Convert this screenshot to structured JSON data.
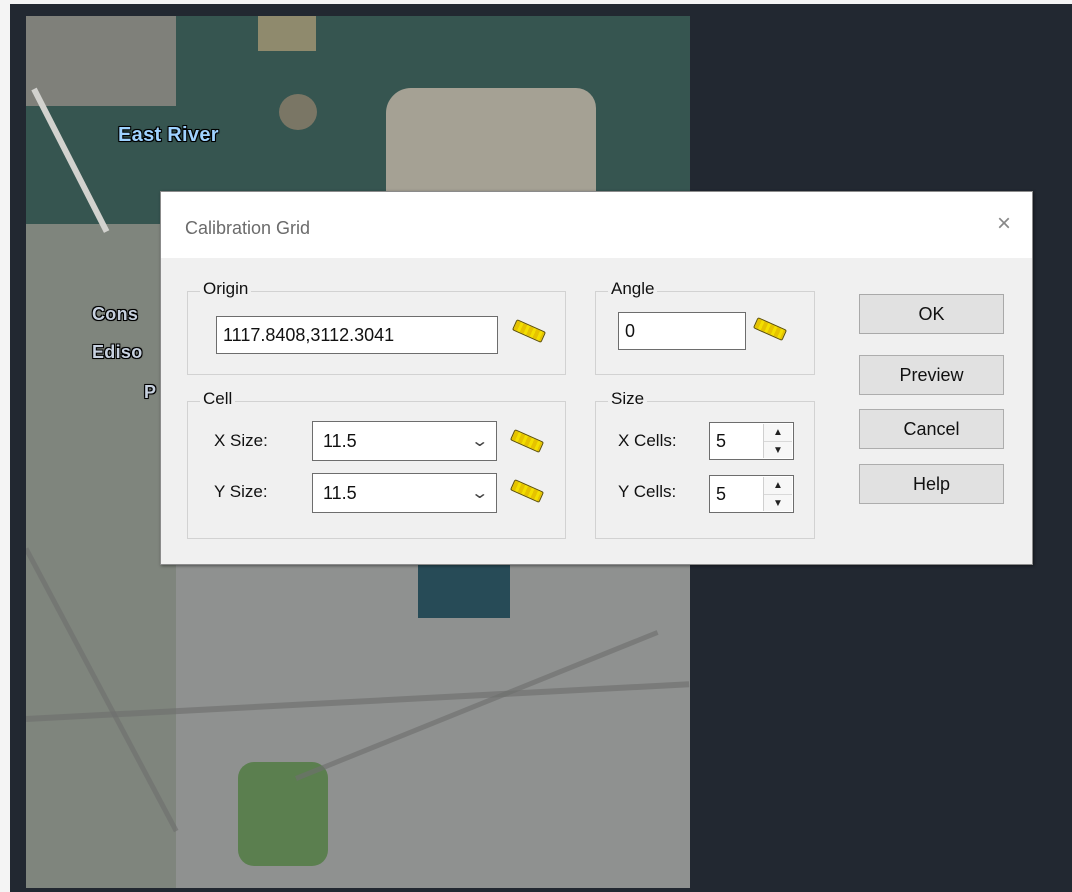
{
  "map": {
    "labels": [
      {
        "text": "East River"
      },
      {
        "text": "Cons"
      },
      {
        "text": "Ediso"
      },
      {
        "text": "P"
      }
    ]
  },
  "dialog": {
    "title": "Calibration Grid",
    "close_icon": "close-icon",
    "origin": {
      "group_label": "Origin",
      "value": "1117.8408,3112.3041",
      "ruler_icon": "ruler-icon"
    },
    "angle": {
      "group_label": "Angle",
      "value": "0",
      "ruler_icon": "ruler-icon"
    },
    "cell": {
      "group_label": "Cell",
      "x_label": "X Size:",
      "x_value": "11.5",
      "y_label": "Y Size:",
      "y_value": "11.5"
    },
    "size": {
      "group_label": "Size",
      "x_label": "X Cells:",
      "x_value": "5",
      "y_label": "Y Cells:",
      "y_value": "5"
    },
    "buttons": {
      "ok": "OK",
      "preview": "Preview",
      "cancel": "Cancel",
      "help": "Help"
    }
  },
  "colors": {
    "background_frame": "#222831",
    "dialog_bg": "#f0f0f0",
    "ruler": "#f3df00"
  }
}
